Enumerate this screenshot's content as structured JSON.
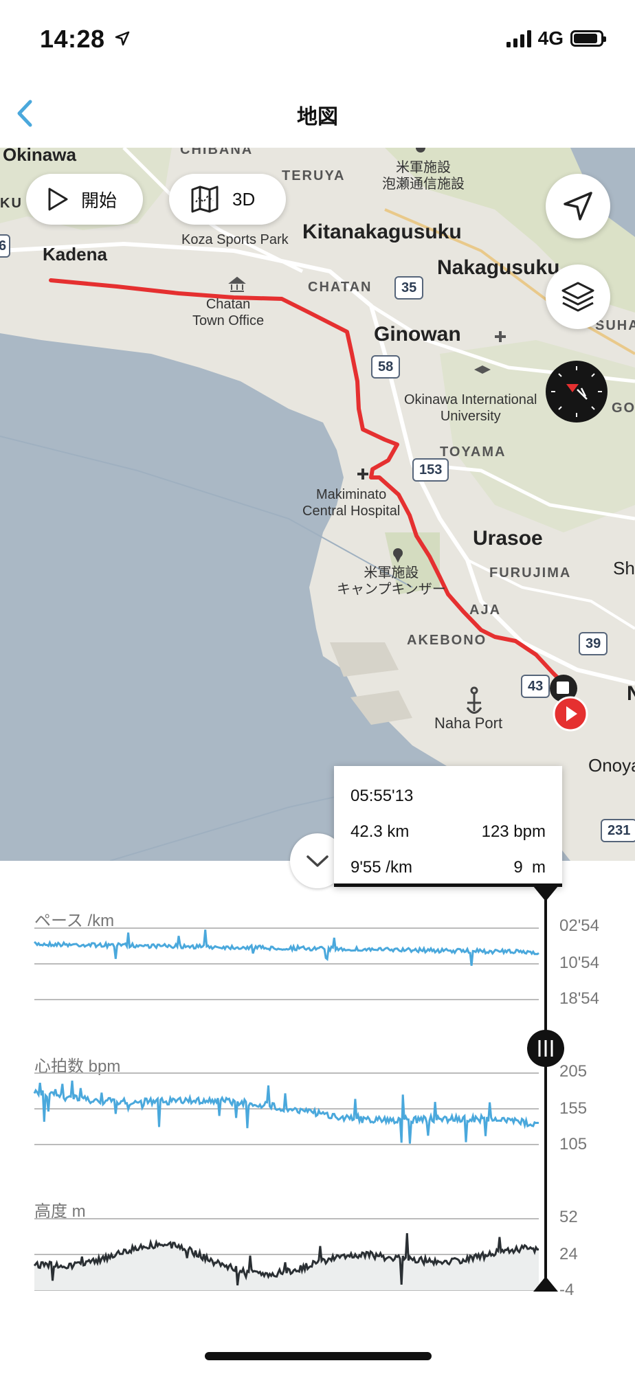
{
  "status_bar": {
    "time": "14:28",
    "network": "4G",
    "icons": [
      "location-arrow-icon",
      "signal-bars-icon",
      "battery-icon"
    ]
  },
  "nav": {
    "title": "地図",
    "back_icon": "chevron-left-icon"
  },
  "map": {
    "controls": {
      "start_label": "開始",
      "view3d_label": "3D",
      "icons": [
        "play-outline-icon",
        "map-3d-icon",
        "navigate-arrow-icon",
        "layers-icon",
        "compass-icon"
      ]
    },
    "labels": {
      "okinawa": "Okinawa",
      "kadena": "Kadena",
      "teruya": "TERUYA",
      "chibana": "CHIBANA",
      "ku": "KU",
      "koza": "Koza Sports Park",
      "kitanakagusuku": "Kitanakagusuku",
      "nakagusuku": "Nakagusuku",
      "chatan": "CHATAN",
      "chatan_office": "Chatan\nTown Office",
      "ginowan": "Ginowan",
      "oiu": "Okinawa International\nUniversity",
      "toyama": "TOYAMA",
      "makiminato": "Makiminato\nCentral Hospital",
      "urasoe": "Urasoe",
      "furujima": "FURUJIMA",
      "military1": "米軍施設\n泡瀬通信施設",
      "military2": "米軍施設\nキャンプキンザー",
      "aja": "AJA",
      "akebono": "AKEBONO",
      "naha_port": "Naha Port",
      "onoya": "Onoya",
      "suha": "SUHA",
      "go": "GO",
      "shu": "Shu",
      "n": "N"
    },
    "shields": [
      "35",
      "58",
      "153",
      "39",
      "43",
      "231",
      "6"
    ]
  },
  "tooltip": {
    "time": "05:55'13",
    "distance": "42.3 km",
    "heart_rate": "123 bpm",
    "pace": "9'55 /km",
    "altitude": "9  m"
  },
  "charts": {
    "pace": {
      "title": "ペース /km",
      "ticks": [
        "02'54",
        "10'54",
        "18'54"
      ],
      "color": "#4aa8dc"
    },
    "heart_rate": {
      "title": "心拍数 bpm",
      "ticks": [
        "205",
        "155",
        "105"
      ],
      "color": "#4aa8dc"
    },
    "altitude": {
      "title": "高度 m",
      "ticks": [
        "52",
        "24",
        "-4"
      ],
      "color": "#2a2f33"
    }
  },
  "accent_color": "#4aa8dc",
  "route_color": "#e03030"
}
